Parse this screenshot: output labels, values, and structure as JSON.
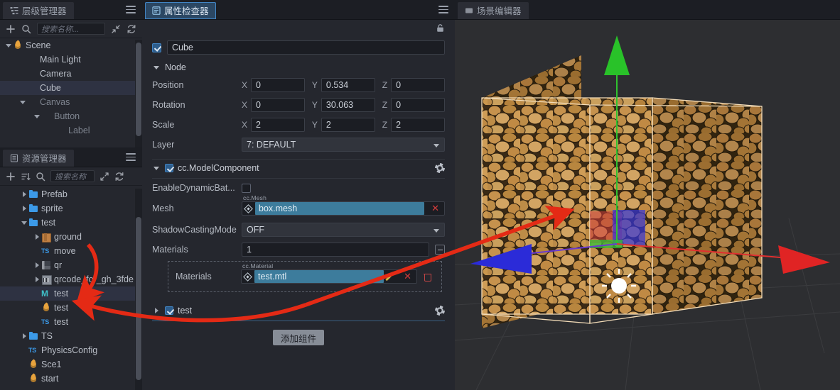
{
  "hierarchy": {
    "tab_label": "层级管理器",
    "tab_icon": "hierarchy-icon",
    "search_placeholder": "搜索名称...",
    "items": [
      {
        "label": "Scene",
        "indent": 0,
        "arrow": "down",
        "icon": "flame-icon",
        "selected": false,
        "dim": false
      },
      {
        "label": "Main Light",
        "indent": 1,
        "arrow": "none",
        "icon": "none",
        "selected": false,
        "dim": false
      },
      {
        "label": "Camera",
        "indent": 1,
        "arrow": "none",
        "icon": "none",
        "selected": false,
        "dim": false
      },
      {
        "label": "Cube",
        "indent": 1,
        "arrow": "none",
        "icon": "none",
        "selected": true,
        "dim": false
      },
      {
        "label": "Canvas",
        "indent": 1,
        "arrow": "down",
        "icon": "none",
        "selected": false,
        "dim": true
      },
      {
        "label": "Button",
        "indent": 2,
        "arrow": "down",
        "icon": "none",
        "selected": false,
        "dim": true
      },
      {
        "label": "Label",
        "indent": 3,
        "arrow": "none",
        "icon": "none",
        "selected": false,
        "dim": true
      }
    ]
  },
  "assets": {
    "tab_label": "资源管理器",
    "tab_icon": "assets-icon",
    "search_placeholder": "搜索名称",
    "items": [
      {
        "label": "Prefab",
        "indent": 1,
        "arrow": "right",
        "icon": "folder-icon",
        "selected": false
      },
      {
        "label": "sprite",
        "indent": 1,
        "arrow": "right",
        "icon": "folder-icon",
        "selected": false
      },
      {
        "label": "test",
        "indent": 1,
        "arrow": "down",
        "icon": "folder-icon",
        "selected": false
      },
      {
        "label": "ground",
        "indent": 2,
        "arrow": "right",
        "icon": "box-icon",
        "selected": false
      },
      {
        "label": "move",
        "indent": 2,
        "arrow": "none",
        "icon": "ts-icon",
        "selected": false
      },
      {
        "label": "qr",
        "indent": 2,
        "arrow": "right",
        "icon": "qr-icon",
        "selected": false
      },
      {
        "label": "qrcode_for_gh_3fde",
        "indent": 2,
        "arrow": "right",
        "icon": "image-icon",
        "selected": false
      },
      {
        "label": "test",
        "indent": 2,
        "arrow": "none",
        "icon": "material-icon",
        "selected": true
      },
      {
        "label": "test",
        "indent": 2,
        "arrow": "none",
        "icon": "flame-icon",
        "selected": false
      },
      {
        "label": "test",
        "indent": 2,
        "arrow": "none",
        "icon": "ts-icon",
        "selected": false
      },
      {
        "label": "TS",
        "indent": 1,
        "arrow": "right",
        "icon": "folder-icon",
        "selected": false
      },
      {
        "label": "PhysicsConfig",
        "indent": 1,
        "arrow": "none",
        "icon": "ts-icon",
        "selected": false
      },
      {
        "label": "Sce1",
        "indent": 1,
        "arrow": "none",
        "icon": "flame-icon",
        "selected": false
      },
      {
        "label": "start",
        "indent": 1,
        "arrow": "none",
        "icon": "flame-icon",
        "selected": false
      }
    ]
  },
  "inspector": {
    "tab_label": "属性检查器",
    "tab_icon": "inspector-icon",
    "node_enabled": true,
    "node_name": "Cube",
    "node_section_label": "Node",
    "transform": [
      {
        "label": "Position",
        "x": "0",
        "y": "0.534",
        "z": "0"
      },
      {
        "label": "Rotation",
        "x": "0",
        "y": "30.063",
        "z": "0"
      },
      {
        "label": "Scale",
        "x": "2",
        "y": "2",
        "z": "2"
      }
    ],
    "axis_labels": {
      "x": "X",
      "y": "Y",
      "z": "Z"
    },
    "layer_label": "Layer",
    "layer_value": "7: DEFAULT",
    "component": {
      "title": "cc.ModelComponent",
      "enabled": true,
      "dynamic_batching_label": "EnableDynamicBat...",
      "dynamic_batching_checked": false,
      "mesh_label": "Mesh",
      "mesh_type": "cc.Mesh",
      "mesh_value": "box.mesh",
      "shadow_label": "ShadowCastingMode",
      "shadow_value": "OFF",
      "materials_label": "Materials",
      "materials_count": "1",
      "material_item_label": "Materials",
      "material_type": "cc.Material",
      "material_value": "test.mtl"
    },
    "script_component": {
      "title": "test",
      "enabled": true
    },
    "add_component_label": "添加组件"
  },
  "scene": {
    "tab_label": "场景编辑器",
    "tab_icon": "scene-icon",
    "gizmo": {
      "x_axis_color": "#e03030",
      "y_axis_color": "#2fc22f",
      "z_axis_color": "#2b2bd8"
    },
    "selection_outline_color": "#f5d9b0"
  },
  "annotations": {
    "arrow_color": "#e42a15",
    "arrows": [
      {
        "name": "material-asset-to-property",
        "from": "asset-tree-item-test-material",
        "to": "inspector-material-field"
      },
      {
        "name": "asset-ground-to-tree",
        "from": "asset-tree-ground",
        "to": "asset-tree-item-test-material"
      },
      {
        "name": "material-property-to-cube",
        "from": "inspector-material-field",
        "to": "scene-cube"
      }
    ]
  }
}
